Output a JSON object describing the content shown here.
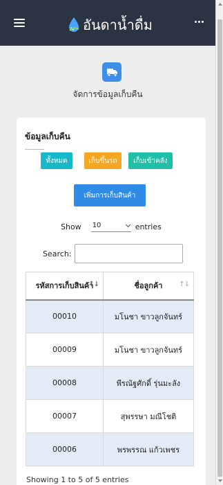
{
  "header": {
    "brand": "อันดาน้ำดื่ม",
    "colors": {
      "bar": "#2b3442",
      "drop": "#4aa3ff"
    }
  },
  "module": {
    "icon": "truck-icon",
    "title": "จัดการข้อมูลเก็บคืน"
  },
  "card": {
    "title": "ข้อมูลเก็บคืน",
    "filters": [
      {
        "label": "ทั้งหมด",
        "color": "#17b8c9"
      },
      {
        "label": "เก็บขึ้นรถ",
        "color": "#f5a623"
      },
      {
        "label": "เก็บเข้าคลัง",
        "color": "#1fc0a7"
      }
    ],
    "add_button": "เพิ่มการเก็บสินค้า",
    "length": {
      "show": "Show",
      "value": "10",
      "entries": "entries"
    },
    "search_label": "Search:",
    "table": {
      "headers": [
        "รหัสการเก็บสินค้า",
        "ชื่อลูกค้า"
      ],
      "rows": [
        [
          "00010",
          "มโนชา ขาวลูกจันทร์"
        ],
        [
          "00009",
          "มโนชา ขาวลูกจันทร์"
        ],
        [
          "00008",
          "พีรณัฐศักดิ์ รุ่นมะลัง"
        ],
        [
          "00007",
          "สุพรรษา มณีโชติ"
        ],
        [
          "00006",
          "พรพรรณ แก้วเพชร"
        ]
      ]
    },
    "info": "Showing 1 to 5 of 5 entries"
  }
}
